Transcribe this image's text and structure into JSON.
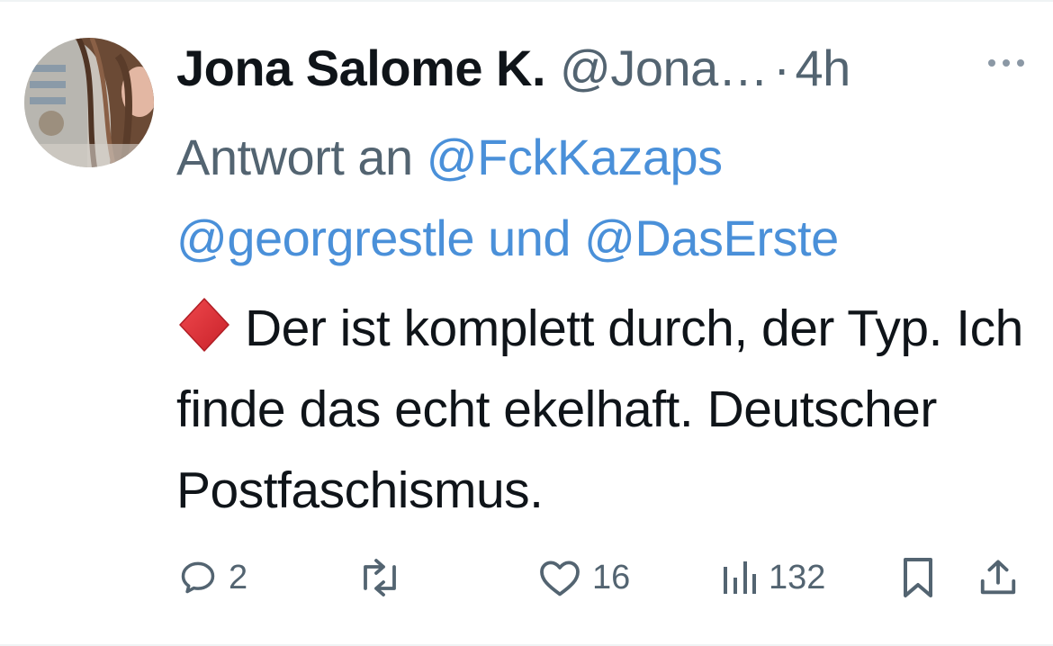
{
  "tweet": {
    "author": {
      "display_name": "Jona Salome K.",
      "handle": "@Jona…",
      "avatar_icon": "avatar-photo"
    },
    "separator": "·",
    "time": "4h",
    "more_icon": "more-horizontal-icon",
    "reply_to": {
      "prefix": "Antwort an",
      "mention_1": "@FckKazaps",
      "mention_2": "@georgrestle",
      "joiner": "und",
      "mention_3": "@DasErste"
    },
    "text": {
      "emoji": "red-diamond-icon",
      "content": "Der ist komplett durch, der Typ. Ich finde das echt ekelhaft. Deutscher Postfaschismus."
    },
    "actions": {
      "replies": "2",
      "retweets": "",
      "likes": "16",
      "views": "132"
    }
  },
  "colors": {
    "text": "#0f1419",
    "secondary": "#536471",
    "link": "#4a90d9",
    "diamond": "#e0343a"
  }
}
